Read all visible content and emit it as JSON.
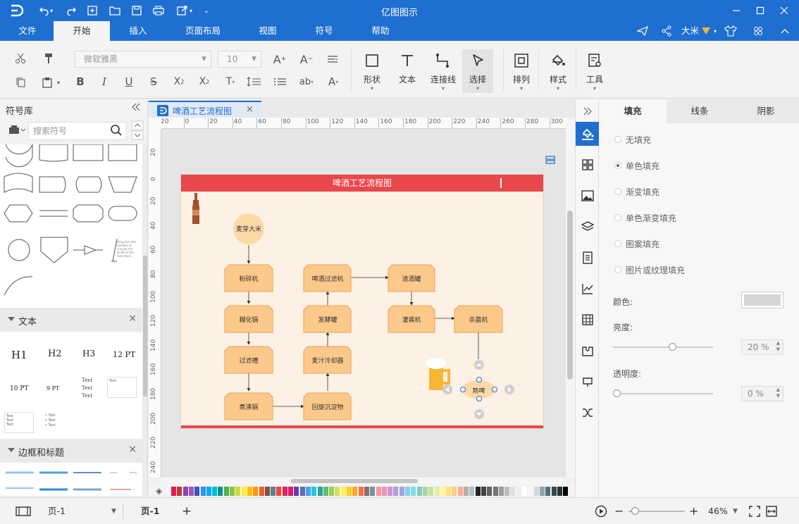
{
  "window": {
    "title": "亿图图示"
  },
  "menu": [
    {
      "label": "文件",
      "active": false
    },
    {
      "label": "开始",
      "active": true
    },
    {
      "label": "插入",
      "active": false
    },
    {
      "label": "页面布局",
      "active": false
    },
    {
      "label": "视图",
      "active": false
    },
    {
      "label": "符号",
      "active": false
    },
    {
      "label": "帮助",
      "active": false
    }
  ],
  "user": {
    "name": "大米"
  },
  "ribbon": {
    "font_family": "微软雅黑",
    "font_size": "10",
    "big_buttons": [
      "形状",
      "文本",
      "连接线",
      "选择",
      "排列",
      "样式",
      "工具"
    ]
  },
  "library": {
    "title": "符号库",
    "search_placeholder": "搜索符号",
    "shape_text": "Drag the side handles to change the width of the text block.",
    "text_section": "文本",
    "text_samples": [
      "H1",
      "H2",
      "H3",
      "12 PT",
      "10 PT",
      "9 PT",
      "Text",
      "Text",
      "Text",
      "Text",
      "Text",
      "Text",
      "Text",
      "Text",
      "Text",
      "Text",
      "Text"
    ],
    "border_section": "边框和标题"
  },
  "doc_tab": {
    "label": "啤酒工艺流程图"
  },
  "ruler": {
    "h": [
      "20",
      "0",
      "20",
      "40",
      "60",
      "80",
      "100",
      "120",
      "140",
      "160",
      "180",
      "200",
      "220",
      "240",
      "260",
      "280",
      "300"
    ],
    "v": [
      "20",
      "0",
      "20",
      "40",
      "60",
      "80",
      "100",
      "120",
      "140",
      "160",
      "180",
      "200",
      "220",
      "240"
    ]
  },
  "diagram": {
    "title": "啤酒工艺流程图",
    "nodes": [
      {
        "label": "麦芽大米"
      },
      {
        "label": "粉碎机"
      },
      {
        "label": "糊化锅"
      },
      {
        "label": "过滤槽"
      },
      {
        "label": "煮沸锅"
      },
      {
        "label": "啤酒过滤机"
      },
      {
        "label": "发酵罐"
      },
      {
        "label": "麦汁冷却器"
      },
      {
        "label": "回旋沉淀物"
      },
      {
        "label": "清酒罐"
      },
      {
        "label": "灌装机"
      },
      {
        "label": "杀菌机"
      },
      {
        "label": "熟啤"
      }
    ]
  },
  "props": {
    "tabs": [
      "填充",
      "线条",
      "阴影"
    ],
    "fill_options": [
      {
        "label": "无填充",
        "selected": false
      },
      {
        "label": "单色填充",
        "selected": true
      },
      {
        "label": "渐变填充",
        "selected": false
      },
      {
        "label": "单色渐变填充",
        "selected": false
      },
      {
        "label": "图案填充",
        "selected": false
      },
      {
        "label": "图片或纹理填充",
        "selected": false
      }
    ],
    "color_label": "颜色:",
    "brightness_label": "亮度:",
    "brightness_value": "20 %",
    "brightness": 0.2,
    "transparency_label": "透明度:",
    "transparency_value": "0 %",
    "transparency": 0
  },
  "status": {
    "page_select": "页-1",
    "page_tab": "页-1",
    "zoom": "46%"
  },
  "colors": {
    "brand": "#1f6fd0",
    "header_red": "#e8474b",
    "node_fill": "#fcc98b",
    "node_stroke": "#e3a259",
    "circle_fill": "#fdd9a8",
    "page_bg": "#fdf0e4"
  },
  "icons": [
    "logo-icon",
    "undo-icon",
    "redo-icon",
    "new-icon",
    "open-icon",
    "save-icon",
    "print-icon",
    "export-icon",
    "minimize-icon",
    "maximize-icon",
    "close-icon",
    "share-icon",
    "shirt-icon",
    "grid-icon",
    "beer-bottle-icon",
    "beer-mug-icon"
  ]
}
